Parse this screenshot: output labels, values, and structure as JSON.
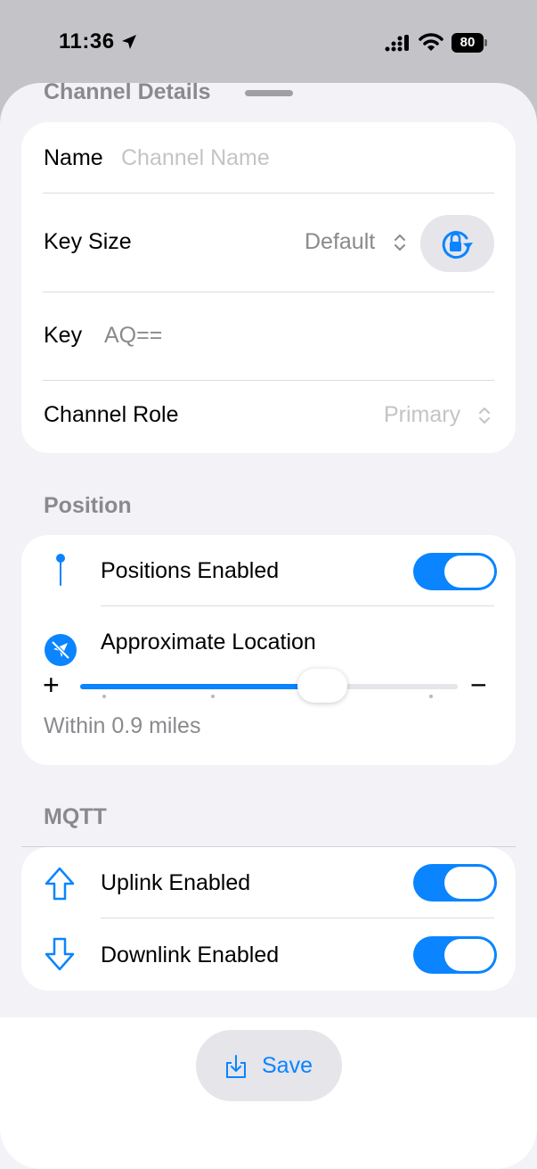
{
  "status_bar": {
    "time": "11:36",
    "battery": "80"
  },
  "sheet": {
    "title": "Channel Details"
  },
  "channel": {
    "name_label": "Name",
    "name_placeholder": "Channel Name",
    "key_size_label": "Key Size",
    "key_size_value": "Default",
    "key_label": "Key",
    "key_value": "AQ==",
    "role_label": "Channel Role",
    "role_value": "Primary"
  },
  "position": {
    "header": "Position",
    "positions_enabled_label": "Positions Enabled",
    "positions_enabled": true,
    "approx_label": "Approximate Location",
    "slider_fraction": 0.62,
    "plus_symbol": "+",
    "minus_symbol": "−",
    "precision_text": "Within 0.9 miles"
  },
  "mqtt": {
    "header": "MQTT",
    "uplink_label": "Uplink Enabled",
    "uplink_enabled": true,
    "downlink_label": "Downlink Enabled",
    "downlink_enabled": true
  },
  "footer": {
    "save_label": "Save"
  },
  "colors": {
    "accent": "#0a84ff",
    "secondary_text": "#8a8a8e",
    "background": "#f2f2f7"
  },
  "icons": [
    "location-arrow-icon",
    "cellular-icon",
    "wifi-icon",
    "battery-icon",
    "lock-rotate-icon",
    "pin-icon",
    "location-slash-icon",
    "arrow-up-icon",
    "arrow-down-icon",
    "save-tray-icon"
  ]
}
